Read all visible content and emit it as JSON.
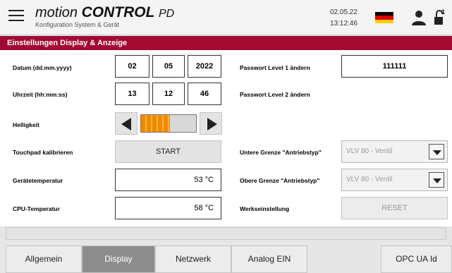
{
  "header": {
    "brand_word1": "motion",
    "brand_word2": "CONTROL",
    "brand_suffix": "PD",
    "subtitle": "Konfiguration System & Gerät",
    "date": "02.05.22",
    "time": "13:12:46",
    "flag_colors": [
      "#000000",
      "#dd0000",
      "#ffce00"
    ],
    "user_icon": "user-icon",
    "lock_icon": "lock-open-icon",
    "lock_level": "1"
  },
  "section": {
    "title": "Einstellungen Display & Anzeige"
  },
  "left": {
    "datum_label": "Datum (dd.mm.yyyy)",
    "datum_day": "02",
    "datum_month": "05",
    "datum_year": "2022",
    "uhrzeit_label": "Uhrzeit (hh:mm:ss)",
    "uhr_h": "13",
    "uhr_m": "12",
    "uhr_s": "46",
    "helligkeit_label": "Helligkeit",
    "helligkeit_level": 0.53,
    "touch_label": "Touchpad kalibrieren",
    "touch_button": "START",
    "geraet_label": "Gerätetemperatur",
    "geraet_value": "53  °C",
    "cpu_label": "CPU-Temperatur",
    "cpu_value": "58  °C"
  },
  "right": {
    "pw1_label": "Passwort Level 1 ändern",
    "pw1_value": "111111",
    "pw2_label": "Passwort Level 2 ändern",
    "untere_label": "Untere Grenze \"Antriebstyp\"",
    "untere_value": "VLV 80 - Ventil",
    "obere_label": "Obere Grenze \"Antriebstyp\"",
    "obere_value": "VLV 80 - Ventil",
    "werk_label": "Werkseinstellung",
    "werk_button": "RESET"
  },
  "tabs": [
    {
      "label": "Allgemein",
      "active": false
    },
    {
      "label": "Display",
      "active": true
    },
    {
      "label": "Netzwerk",
      "active": false
    },
    {
      "label": "Analog EIN",
      "active": false
    },
    {
      "label": "OPC UA Id",
      "active": false
    }
  ],
  "colors": {
    "accent": "#a30a32",
    "brightness_fill": "#f08a00",
    "active_tab": "#8d8d8d"
  }
}
